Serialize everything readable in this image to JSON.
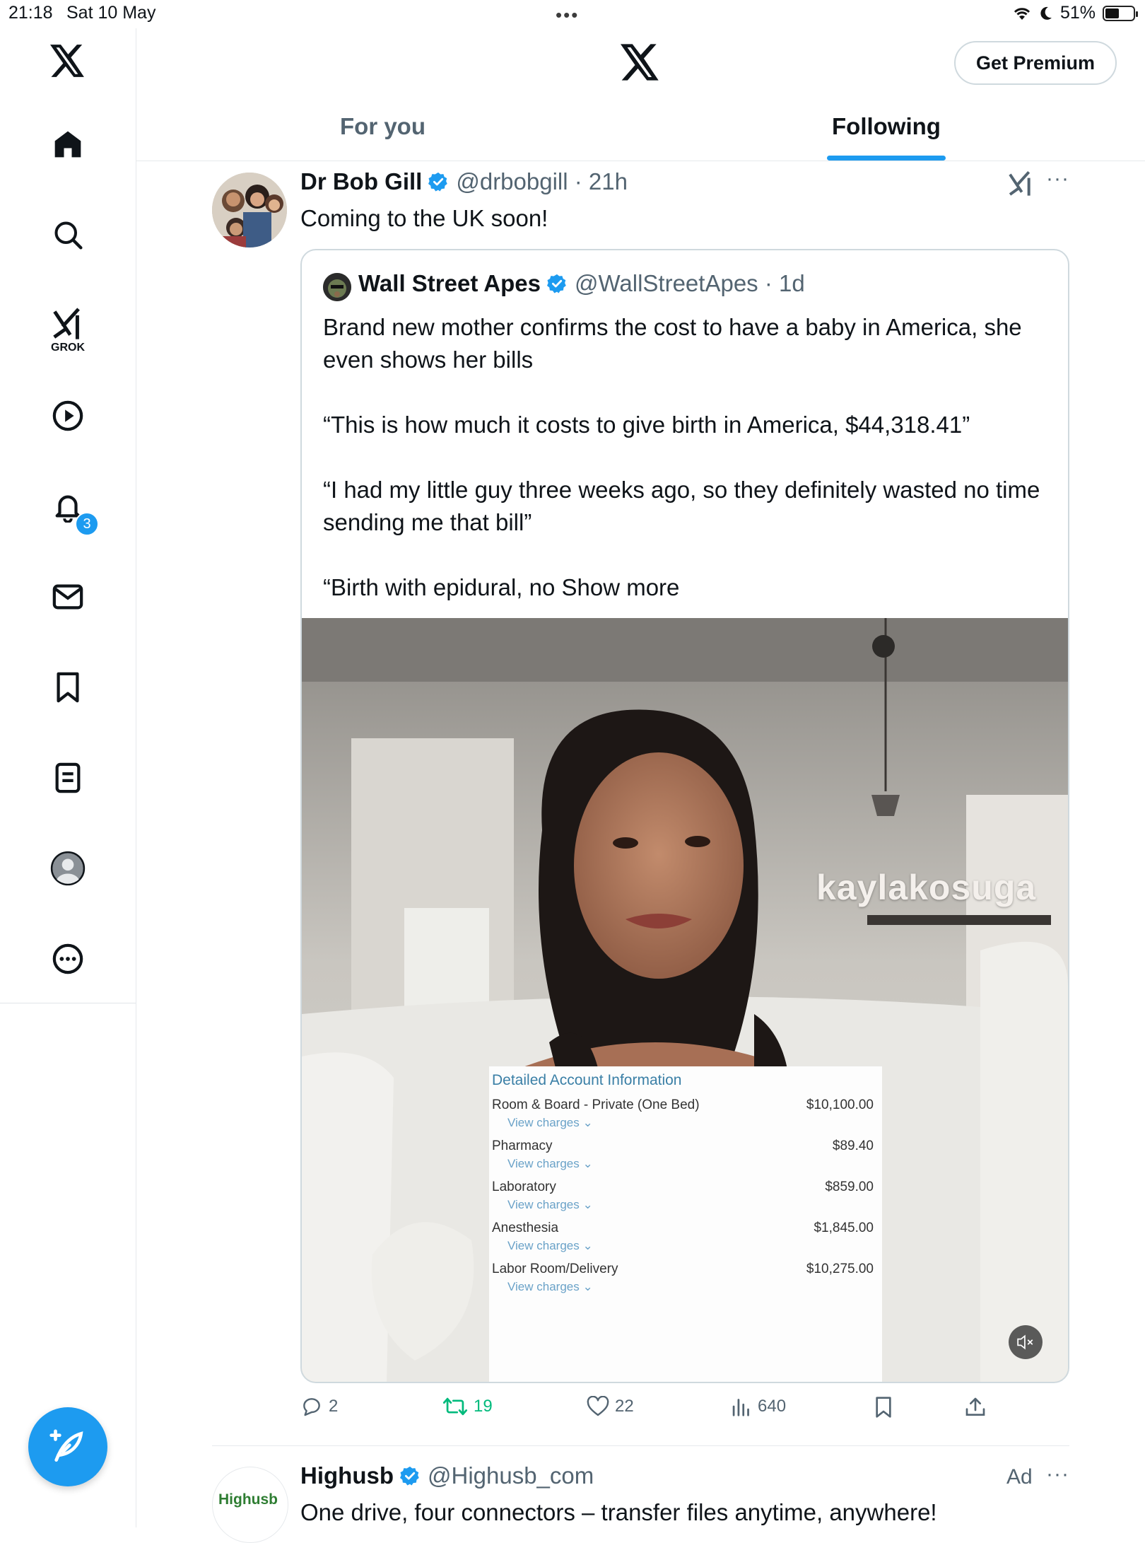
{
  "status_bar": {
    "time": "21:18",
    "date": "Sat 10 May",
    "battery": "51%",
    "battery_level": 0.51
  },
  "sidebar": {
    "items": [
      {
        "icon": "x-logo-icon"
      },
      {
        "icon": "home-icon"
      },
      {
        "icon": "search-icon"
      },
      {
        "icon": "grok-icon",
        "label": "GROK"
      },
      {
        "icon": "video-play-icon"
      },
      {
        "icon": "bell-icon",
        "badge": "3"
      },
      {
        "icon": "mail-icon"
      },
      {
        "icon": "bookmark-icon"
      },
      {
        "icon": "list-icon"
      },
      {
        "icon": "profile-icon"
      },
      {
        "icon": "more-icon"
      }
    ],
    "compose_icon": "compose-feather-icon"
  },
  "header": {
    "premium_label": "Get Premium",
    "tabs": [
      {
        "label": "For you",
        "active": false
      },
      {
        "label": "Following",
        "active": true
      }
    ]
  },
  "post": {
    "author_name": "Dr Bob Gill",
    "handle_time": "@drbobgill · 21h",
    "text": "Coming to the UK soon!",
    "quote": {
      "author_name": "Wall Street Apes",
      "handle_time": "@WallStreetApes · 1d",
      "paragraphs": [
        "Brand new mother confirms the cost to have a baby in America, she even shows her bills",
        "“This is how much it costs to give birth in America, $44,318.41”",
        "“I had my little guy three weeks ago, so they definitely wasted no time sending me that bill”"
      ],
      "last_line": "“Birth with epidural, no ",
      "show_more": "Show more",
      "media": {
        "watermark": "kaylakosuga",
        "bill_title": "Detailed Account Information",
        "view_charges": "View charges",
        "bill_rows": [
          {
            "label": "Room & Board - Private (One Bed)",
            "amount": "$10,100.00"
          },
          {
            "label": "Pharmacy",
            "amount": "$89.40"
          },
          {
            "label": "Laboratory",
            "amount": "$859.00"
          },
          {
            "label": "Anesthesia",
            "amount": "$1,845.00"
          },
          {
            "label": "Labor Room/Delivery",
            "amount": "$10,275.00"
          }
        ]
      }
    },
    "actions": {
      "replies": "2",
      "reposts": "19",
      "likes": "22",
      "views": "640"
    },
    "colors": {
      "repost_green": "#00ba7c",
      "accent": "#1d9bf0"
    }
  },
  "ad": {
    "avatar_text": "Highusb",
    "author_name": "Highusb",
    "handle": "@Highusb_com",
    "label": "Ad",
    "text": "One drive, four connectors – transfer files anytime, anywhere!"
  }
}
